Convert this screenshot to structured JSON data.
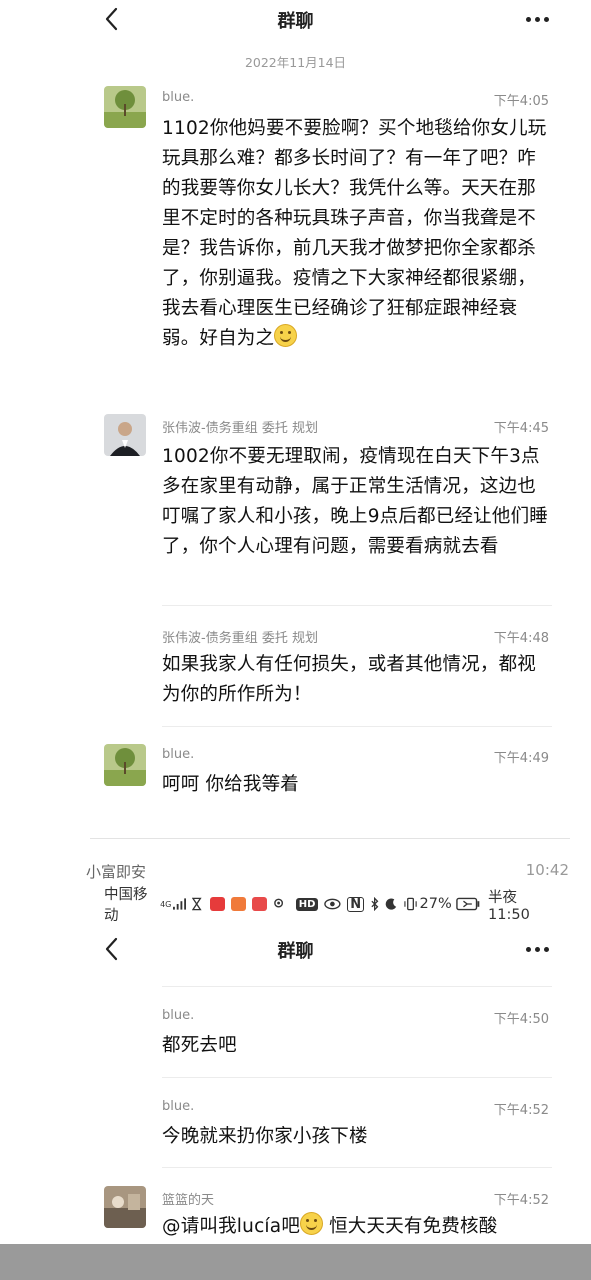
{
  "top": {
    "title": "群聊",
    "date": "2022年11月14日"
  },
  "messages_top": [
    {
      "name": "blue.",
      "time": "下午4:05",
      "text": "1102你他妈要不要脸啊？买个地毯给你女儿玩玩具那么难？都多长时间了？有一年了吧？咋的我要等你女儿长大？我凭什么等。天天在那里不定时的各种玩具珠子声音，你当我聋是不是？我告诉你，前几天我才做梦把你全家都杀了，你别逼我。疫情之下大家神经都很紧绷，我去看心理医生已经确诊了狂郁症跟神经衰弱。好自为之"
    },
    {
      "name": "张伟波-债务重组 委托 规划",
      "time": "下午4:45",
      "text": "1002你不要无理取闹，疫情现在白天下午3点多在家里有动静，属于正常生活情况，这边也叮嘱了家人和小孩，晚上9点后都已经让他们睡了，你个人心理有问题，需要看病就去看"
    },
    {
      "name": "张伟波-债务重组 委托 规划",
      "time": "下午4:48",
      "text": "如果我家人有任何损失，或者其他情况，都视为你的所作所为！"
    },
    {
      "name": "blue.",
      "time": "下午4:49",
      "text": "呵呵 你给我等着"
    }
  ],
  "overlay": {
    "label": "小富即安",
    "time": "10:42"
  },
  "statusbar": {
    "carrier": "中国移动",
    "signal": "4G",
    "battery": "27%",
    "clock": "半夜11:50",
    "hd": "HD",
    "nfc": "N"
  },
  "bottom": {
    "title": "群聊"
  },
  "messages_bottom": [
    {
      "name": "blue.",
      "time": "下午4:50",
      "text": "都死去吧"
    },
    {
      "name": "blue.",
      "time": "下午4:52",
      "text": "今晚就来扔你家小孩下楼"
    },
    {
      "name": "篮篮的天",
      "time": "下午4:52",
      "text_a": "@请叫我lucía吧",
      "text_b": " 恒大天天有免费核酸"
    }
  ]
}
